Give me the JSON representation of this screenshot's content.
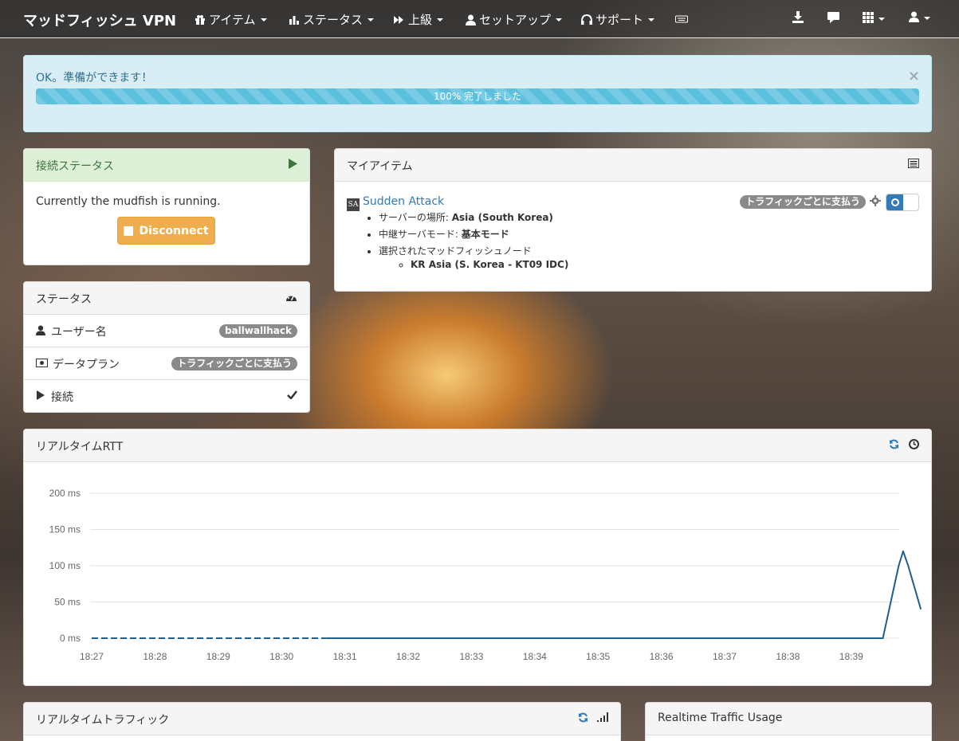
{
  "navbar": {
    "brand": "マッドフィッシュ VPN",
    "items": [
      {
        "label": "アイテム"
      },
      {
        "label": "ステータス"
      },
      {
        "label": "上級"
      },
      {
        "label": "セットアップ"
      },
      {
        "label": "サポート"
      }
    ]
  },
  "alert": {
    "message": "OK。準備ができます！",
    "close": "×",
    "progress_text": "100% 完了しました",
    "progress_value": 100
  },
  "connection_panel": {
    "title": "接続ステータス",
    "status_text": "Currently the mudfish is running.",
    "disconnect_label": "Disconnect"
  },
  "status_panel": {
    "title": "ステータス",
    "rows": [
      {
        "label": "ユーザー名",
        "value": "ballwallhack"
      },
      {
        "label": "データプラン",
        "value": "トラフィックごとに支払う"
      },
      {
        "label": "接続"
      }
    ]
  },
  "my_items_panel": {
    "title": "マイアイテム",
    "item": {
      "icon_text": "SA",
      "name": "Sudden Attack",
      "badge": "トラフィックごとに支払う",
      "details": [
        {
          "key": "サーバーの場所: ",
          "value": "Asia (South Korea)"
        },
        {
          "key": "中継サーバモード: ",
          "value": "基本モード"
        },
        {
          "key": "選択されたマッドフィッシュノード",
          "value": ""
        }
      ],
      "node": "KR Asia (S. Korea - KT09 IDC)"
    }
  },
  "rtt_panel": {
    "title": "リアルタイムRTT"
  },
  "traffic_panel": {
    "title": "リアルタイムトラフィック"
  },
  "usage_panel": {
    "title": "Realtime Traffic Usage"
  },
  "chart_data": {
    "type": "line",
    "yticks": [
      "200 ms",
      "150 ms",
      "100 ms",
      "50 ms",
      "0 ms"
    ],
    "ylim": [
      0,
      200
    ],
    "categories": [
      "18:27",
      "18:28",
      "18:29",
      "18:30",
      "18:31",
      "18:32",
      "18:33",
      "18:34",
      "18:35",
      "18:36",
      "18:37",
      "18:38",
      "18:39"
    ],
    "series": [
      {
        "color": "#1f5f8b",
        "points": [
          [
            0,
            0
          ],
          [
            3.7,
            0
          ],
          [
            12.5,
            0
          ],
          [
            12.65,
            60
          ],
          [
            12.75,
            100
          ],
          [
            12.82,
            120
          ],
          [
            12.9,
            100
          ],
          [
            13.0,
            70
          ],
          [
            13.1,
            40
          ]
        ],
        "dashed_until": 3.7
      }
    ],
    "grid": true
  },
  "colors": {
    "success_heading": "#dff0d8",
    "success_text": "#3c763d",
    "info_bg": "#d9edf7",
    "progress": "#5bc0de",
    "warning": "#f0ad4e",
    "primary": "#337ab7"
  }
}
